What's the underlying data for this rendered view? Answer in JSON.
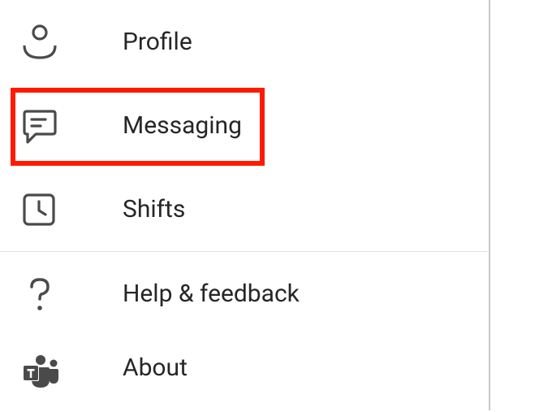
{
  "menu": {
    "items": [
      {
        "key": "profile",
        "label": "Profile",
        "icon": "profile-icon"
      },
      {
        "key": "messaging",
        "label": "Messaging",
        "icon": "messaging-icon",
        "highlighted": true
      },
      {
        "key": "shifts",
        "label": "Shifts",
        "icon": "clock-icon"
      },
      {
        "key": "help",
        "label": "Help & feedback",
        "icon": "question-icon"
      },
      {
        "key": "about",
        "label": "About",
        "icon": "teams-icon"
      }
    ]
  },
  "colors": {
    "icon": "#4a4a4a",
    "text": "#262626",
    "highlight_border": "#ff1a00",
    "divider": "#e1e1e1"
  }
}
